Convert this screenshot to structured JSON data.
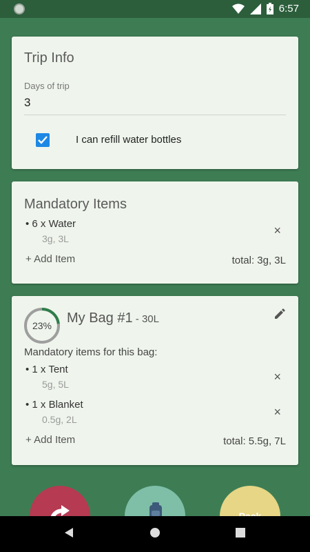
{
  "status_bar": {
    "time": "6:57"
  },
  "trip_info": {
    "title": "Trip Info",
    "days_label": "Days of trip",
    "days_value": "3",
    "refill_label": "I can refill water bottles",
    "refill_checked": true
  },
  "mandatory": {
    "title": "Mandatory Items",
    "items": [
      {
        "name": "• 6 x Water",
        "meta": "3g, 3L"
      }
    ],
    "add_label": "+ Add Item",
    "total": "total: 3g, 3L"
  },
  "bag": {
    "percent": "23%",
    "percent_value": 0.23,
    "title": "My Bag #1",
    "size": " - 30L",
    "subheading": "Mandatory items for this bag:",
    "items": [
      {
        "name": "• 1 x Tent",
        "meta": "5g, 5L"
      },
      {
        "name": "• 1 x Blanket",
        "meta": "0.5g, 2L"
      }
    ],
    "add_label": "+ Add Item",
    "total": "total: 5.5g, 7L"
  },
  "fabs": {
    "pack_label": "Pack"
  },
  "colors": {
    "accent": "#1e88e5",
    "background": "#3e7d54",
    "ring": "#2e7d4a"
  }
}
